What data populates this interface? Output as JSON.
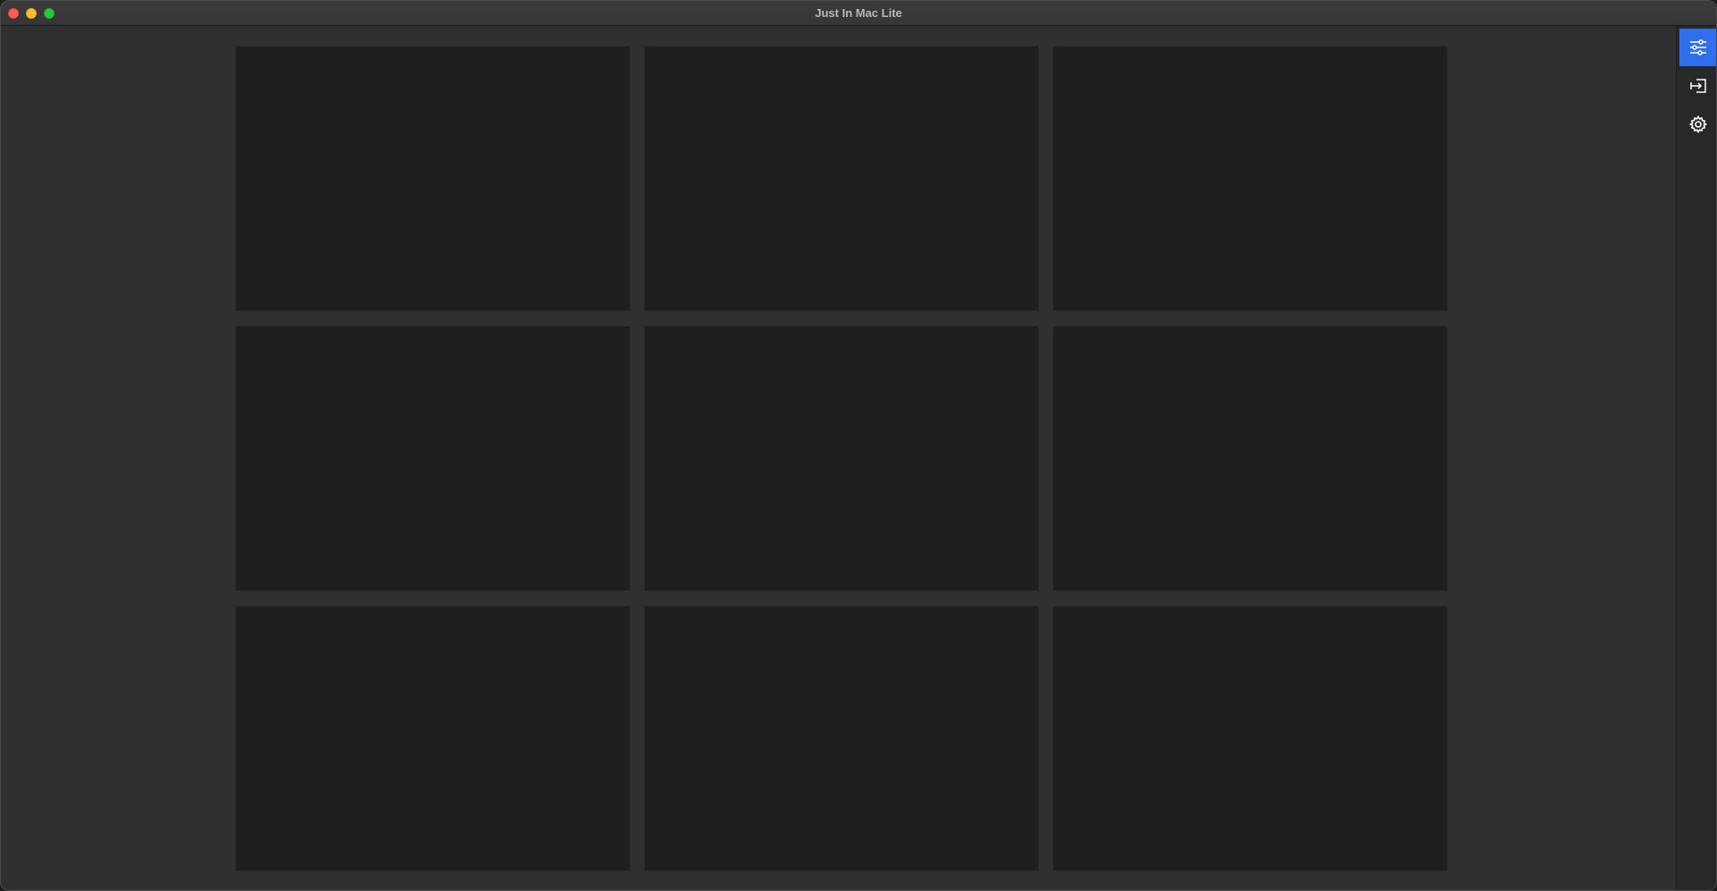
{
  "window": {
    "title": "Just In Mac Lite"
  },
  "grid": {
    "rows": 3,
    "columns": 3,
    "cells": [
      {
        "id": "cell-1"
      },
      {
        "id": "cell-2"
      },
      {
        "id": "cell-3"
      },
      {
        "id": "cell-4"
      },
      {
        "id": "cell-5"
      },
      {
        "id": "cell-6"
      },
      {
        "id": "cell-7"
      },
      {
        "id": "cell-8"
      },
      {
        "id": "cell-9"
      }
    ]
  },
  "sidebar": {
    "items": [
      {
        "icon": "sliders-icon",
        "active": true
      },
      {
        "icon": "input-icon",
        "active": false
      },
      {
        "icon": "gear-icon",
        "active": false
      }
    ]
  },
  "colors": {
    "accent": "#2f6fed",
    "window_bg": "#303030",
    "cell_bg": "#1f1f1f"
  }
}
